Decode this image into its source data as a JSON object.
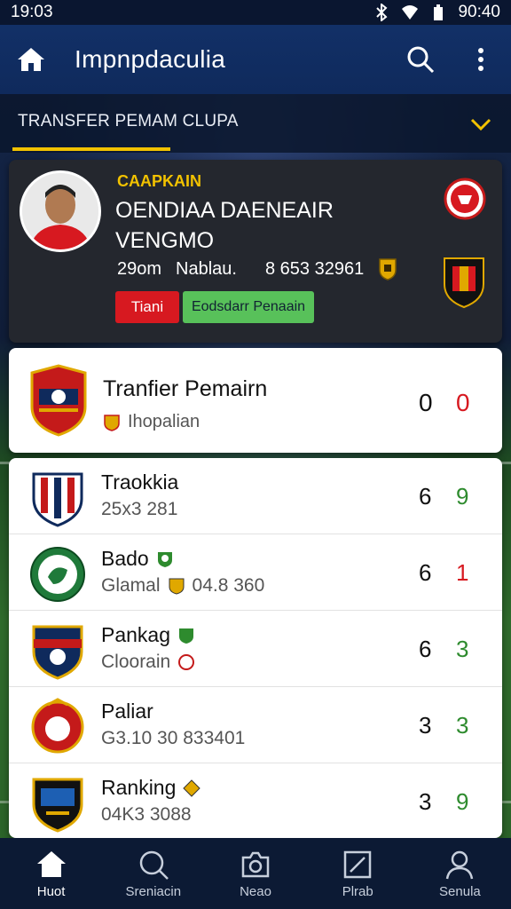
{
  "status_bar": {
    "time_left": "19:03",
    "time_right": "90:40"
  },
  "app_bar": {
    "title": "Impnpdaculia"
  },
  "section": {
    "label": "TRANSFER PEMAM CLUPA"
  },
  "player_card": {
    "tag": "CAAPKAIN",
    "name_line1": "OENDIAA DAENEAIR",
    "name_line2": "VENGMO",
    "meta_a": "29om",
    "meta_b": "Nablau.",
    "meta_num": "8 653 32961",
    "btn_red": "Tiani",
    "btn_green": "Eodsdarr Penaain"
  },
  "featured": {
    "title": "Tranfier Pemairn",
    "subtitle": "Ihopalian",
    "score_a": "0",
    "score_b": "0"
  },
  "rows": [
    {
      "name": "Traokkia",
      "meta": "25x3 281",
      "score_a": "6",
      "score_b": "9",
      "score_b_color": "#2e8b2e"
    },
    {
      "name": "Bado",
      "meta": "Glamal",
      "meta_extra": "04.8 360",
      "score_a": "6",
      "score_b": "1",
      "score_b_color": "#d71920"
    },
    {
      "name": "Pankag",
      "meta": "Cloorain",
      "score_a": "6",
      "score_b": "3",
      "score_b_color": "#2e8b2e"
    },
    {
      "name": "Paliar",
      "meta": "G3.10 30 833401",
      "score_a": "3",
      "score_b": "3",
      "score_b_color": "#2e8b2e"
    },
    {
      "name": "Ranking",
      "meta": "04K3 3088",
      "score_a": "3",
      "score_b": "9",
      "score_b_color": "#2e8b2e"
    }
  ],
  "bottom_nav": [
    {
      "label": "Huot",
      "icon": "home-icon"
    },
    {
      "label": "Sreniacin",
      "icon": "search-icon"
    },
    {
      "label": "Neao",
      "icon": "camera-icon"
    },
    {
      "label": "Plrab",
      "icon": "edit-icon"
    },
    {
      "label": "Senula",
      "icon": "person-icon"
    }
  ],
  "colors": {
    "accent": "#f2c200",
    "primary": "#123067",
    "red": "#d71920",
    "green": "#58c15a"
  }
}
